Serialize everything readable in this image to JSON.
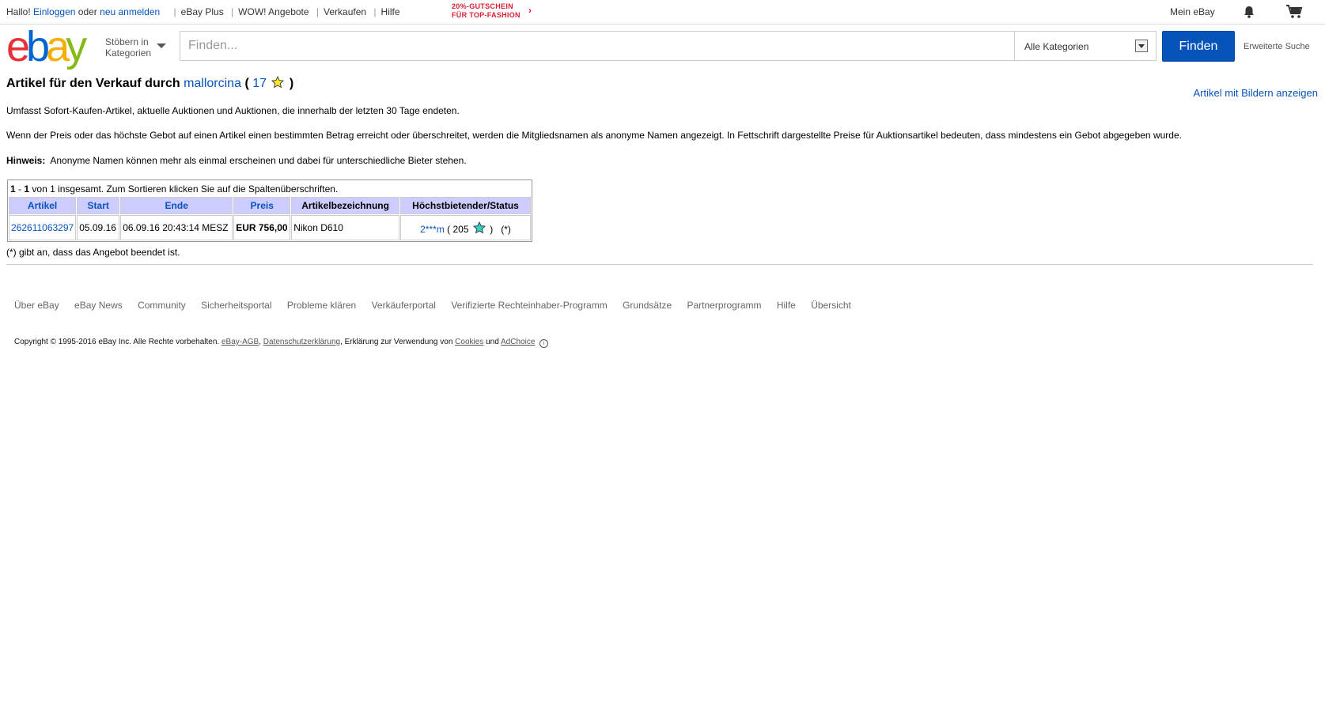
{
  "topbar": {
    "greeting": "Hallo!",
    "login": "Einloggen",
    "or": "oder",
    "register": "neu anmelden",
    "links": [
      "eBay Plus",
      "WOW! Angebote",
      "Verkaufen",
      "Hilfe"
    ],
    "promo_line1": "20%-GUTSCHEIN",
    "promo_line2": "FÜR TOP-FASHION",
    "my_ebay": "Mein eBay"
  },
  "header": {
    "logo": {
      "e": "e",
      "b": "b",
      "a": "a",
      "y": "y"
    },
    "browse_line1": "Stöbern in",
    "browse_line2": "Kategorien",
    "search_placeholder": "Finden...",
    "category": "Alle Kategorien",
    "find_button": "Finden",
    "advanced": "Erweiterte Suche"
  },
  "page": {
    "title_prefix": "Artikel für den Verkauf durch",
    "seller": "mallorcina",
    "open_paren": "(",
    "feedback": "17",
    "close_paren": ")",
    "show_with_images": "Artikel mit Bildern anzeigen",
    "para1": "Umfasst Sofort-Kaufen-Artikel, aktuelle Auktionen und Auktionen, die innerhalb der letzten 30 Tage endeten.",
    "para2": "Wenn der Preis oder das höchste Gebot auf einen Artikel einen bestimmten Betrag erreicht oder überschreitet, werden die Mitgliedsnamen als anonyme Namen angezeigt. In Fettschrift dargestellte Preise für Auktionsartikel bedeuten, dass mindestens ein Gebot abgegeben wurde.",
    "hint_label": "Hinweis:",
    "hint_text": "Anonyme Namen können mehr als einmal erscheinen und dabei für unterschiedliche Bieter stehen."
  },
  "table": {
    "range_start": "1",
    "range_dash": "-",
    "range_end": "1",
    "count_text": "von 1 insgesamt. Zum Sortieren klicken Sie auf die Spaltenüberschriften.",
    "headers": [
      "Artikel",
      "Start",
      "Ende",
      "Preis",
      "Artikelbezeichnung",
      "Höchstbietender/Status"
    ],
    "rows": [
      {
        "item": "262611063297",
        "start": "05.09.16",
        "end": "06.09.16 20:43:14 MESZ",
        "price": "EUR 756,00",
        "title": "Nikon D610",
        "bidder": "2***m",
        "bidder_open": "(",
        "bidder_score": "205",
        "bidder_close": ")",
        "status": "(*)"
      }
    ],
    "footnote": "(*) gibt an, dass das Angebot beendet ist."
  },
  "footer": {
    "links": [
      "Über eBay",
      "eBay News",
      "Community",
      "Sicherheitsportal",
      "Probleme klären",
      "Verkäuferportal",
      "Verifizierte Rechteinhaber-Programm",
      "Grundsätze",
      "Partnerprogramm",
      "Hilfe",
      "Übersicht"
    ],
    "copyright": "Copyright © 1995-2016 eBay Inc. Alle Rechte vorbehalten.",
    "agb": "eBay-AGB",
    "comma1": ",",
    "privacy": "Datenschutzerklärung",
    "comma2": ",",
    "cookies_text": "Erklärung zur Verwendung von",
    "cookies": "Cookies",
    "and": "und",
    "adchoice": "AdChoice",
    "info_glyph": "i"
  },
  "colors": {
    "link": "#0654ba",
    "header_cell": "#ccccff",
    "promo": "#dd1e31",
    "find_button": "#0654ba"
  }
}
